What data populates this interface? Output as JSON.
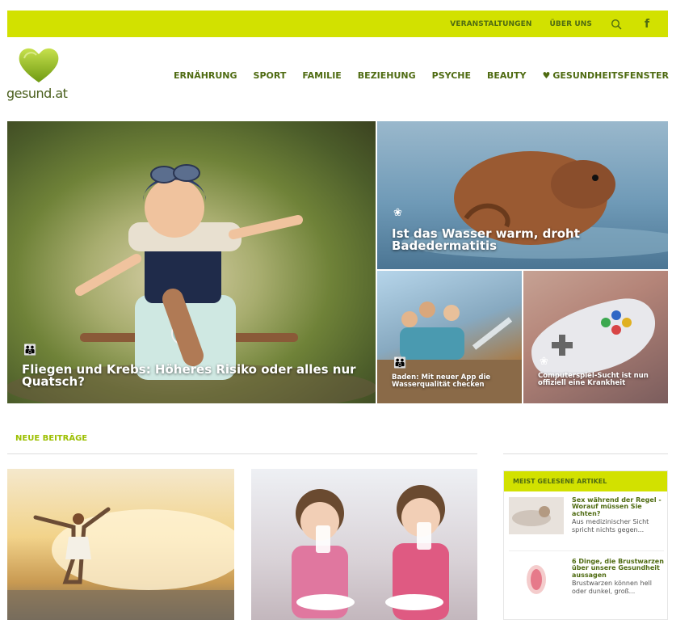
{
  "topbar": {
    "links": [
      "VERANSTALTUNGEN",
      "ÜBER UNS"
    ],
    "icons": [
      "search-icon",
      "facebook-icon"
    ],
    "color": "#d2e100"
  },
  "logo": {
    "text": "gesund.at",
    "color": "#9cbf00"
  },
  "nav": {
    "items": [
      "ERNÄHRUNG",
      "SPORT",
      "FAMILIE",
      "BEZIEHUNG",
      "PSYCHE",
      "BEAUTY",
      "GESUNDHEITSFENSTER"
    ],
    "special_icon": "heart-icon"
  },
  "hero": [
    {
      "title": "Fliegen und Krebs: Höheres Risiko oder alles nur Quatsch?",
      "icon": "family-icon"
    },
    {
      "title": "Ist das Wasser warm, droht Badedermatitis",
      "icon": "leaf-icon"
    },
    {
      "title": "Baden: Mit neuer App die Wasserqualität checken",
      "icon": "family-icon"
    },
    {
      "title": "Computerspiel-Sucht ist nun offiziell eine Krankheit",
      "icon": "leaf-icon"
    }
  ],
  "section": {
    "title": "NEUE BEITRÄGE"
  },
  "sidebar": {
    "title": "MEIST GELESENE ARTIKEL",
    "articles": [
      {
        "title": "Sex während der Regel - Worauf müssen Sie achten?",
        "excerpt": "Aus medizinischer Sicht spricht nichts gegen..."
      },
      {
        "title": "6 Dinge, die Brustwarzen über unsere Gesundheit aussagen",
        "excerpt": "Brustwarzen können hell oder dunkel, groß..."
      }
    ]
  }
}
